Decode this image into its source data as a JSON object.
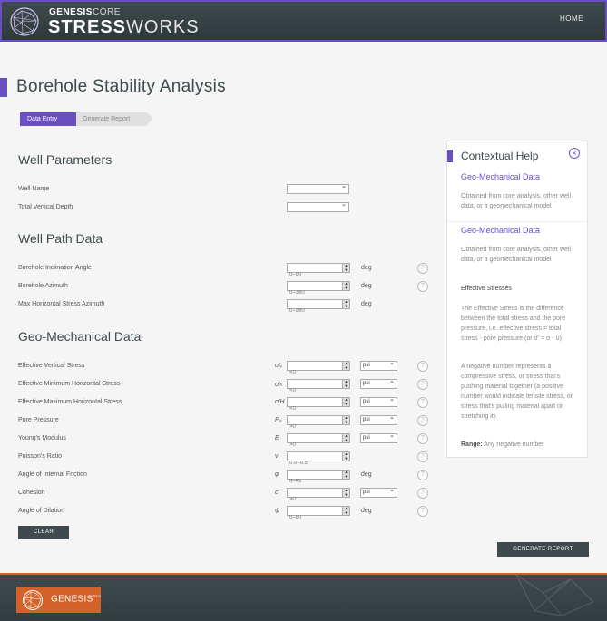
{
  "header": {
    "brand_top_bold": "GENESIS",
    "brand_top_light": "CORE",
    "brand_main_bold": "STRESS",
    "brand_main_light": "WORKS",
    "home_link": "HOME"
  },
  "page": {
    "title": "Borehole Stability Analysis"
  },
  "breadcrumb": {
    "step1": "Data Entry",
    "step2": "Generate Report"
  },
  "well_parameters": {
    "title": "Well Parameters",
    "well_name_label": "Well Name",
    "tvd_label": "Total Vertical Depth"
  },
  "well_path": {
    "title": "Well Path Data",
    "rows": [
      {
        "label": "Borehole Inclination Angle",
        "placeholder": "0–90",
        "unit": "deg"
      },
      {
        "label": "Borehole Azimuth",
        "placeholder": "0–360",
        "unit": "deg"
      },
      {
        "label": "Max Horizontal Stress Azimuth",
        "placeholder": "0–360",
        "unit": "deg"
      }
    ]
  },
  "geo": {
    "title": "Geo-Mechanical Data",
    "rows": [
      {
        "label": "Effective Vertical Stress",
        "symbol": "σ'ᵥ",
        "placeholder": "<0",
        "unit": "psi"
      },
      {
        "label": "Effective Minimum Horizontal Stress",
        "symbol": "σ'ₕ",
        "placeholder": "<0",
        "unit": "psi"
      },
      {
        "label": "Effective Maximum Horizontal Stress",
        "symbol": "σ'H",
        "placeholder": "<0",
        "unit": "psi"
      },
      {
        "label": "Pore Pressure",
        "symbol": "P₀",
        "placeholder": ">0",
        "unit": "psi"
      },
      {
        "label": "Young's Modulus",
        "symbol": "E",
        "placeholder": ">0",
        "unit": "psi"
      },
      {
        "label": "Poisson's Ratio",
        "symbol": "v",
        "placeholder": "0.0–0.5",
        "unit": ""
      },
      {
        "label": "Angle of Internal Friction",
        "symbol": "φ",
        "placeholder": "0–45",
        "unit": "deg"
      },
      {
        "label": "Cohesion",
        "symbol": "c",
        "placeholder": ">0",
        "unit": "psi"
      },
      {
        "label": "Angle of Dilation",
        "symbol": "ψ",
        "placeholder": "0–90",
        "unit": "deg"
      }
    ]
  },
  "buttons": {
    "clear": "CLEAR",
    "generate": "GENERATE REPORT"
  },
  "help": {
    "title": "Contextual Help",
    "heading1": "Geo-Mechanical Data",
    "text1": "Obtained from core analysis, other well data, or a geomechanical model",
    "heading2": "Geo-Mechanical Data",
    "text2": "Obtained from core analysis, other well data, or a geomechanical model",
    "sub": "Effective Stresses",
    "text3": "The Effective Stress is the difference between the total stress and the pore pressure, i.e. effective stress = total stress - pore pressure (or σ' = σ - u)",
    "text4": "A negative number represents a compressive stress, or stress that's pushing material together (a positive number would indicate tensile stress, or stress that's pulling material apart or stretching it).",
    "range_label": "Range:",
    "range_value": "Any negative number"
  },
  "footer": {
    "logo_text": "GENESIS",
    "logo_sup": "RTC"
  },
  "colors": {
    "accent": "#6a4fc3",
    "dark": "#3e4a4d",
    "orange": "#d2622a"
  }
}
